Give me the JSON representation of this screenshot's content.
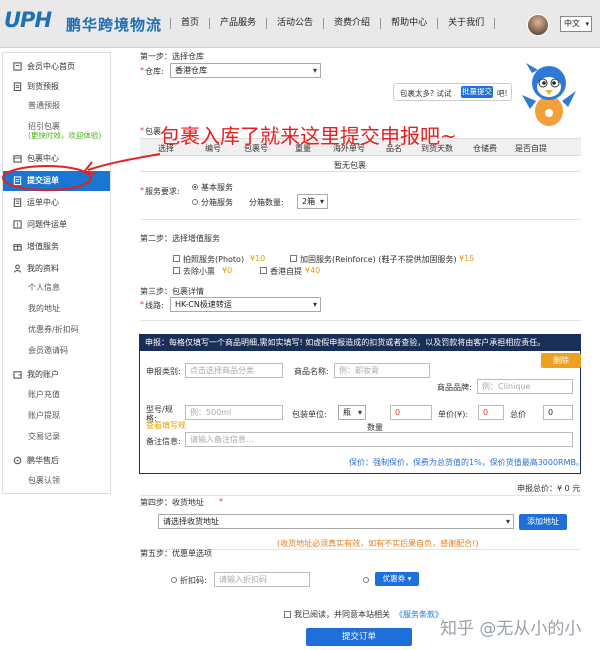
{
  "brand": {
    "logo_mark": "UPH",
    "name": "鹏华跨境物流"
  },
  "nav": [
    "首页",
    "产品服务",
    "活动公告",
    "资费介绍",
    "帮助中心",
    "关于我们"
  ],
  "lang": "中文",
  "sidebar": {
    "home": "会员中心首页",
    "arrival": "到货预报",
    "normal_forecast": "普通预报",
    "claim": "招引包裹",
    "claim_note": "(更快时效，欢迎体验)",
    "package_center": "包裹中心",
    "submit_order": "提交运单",
    "order_center": "运单中心",
    "problem_order": "问题件运单",
    "value_added": "增值服务",
    "my_profile": "我的资料",
    "personal_info": "个人信息",
    "my_address": "我的地址",
    "coupons": "优惠券/折扣码",
    "invite": "会员邀请码",
    "my_account": "我的账户",
    "recharge": "账户充值",
    "withdraw": "账户提现",
    "transactions": "交易记录",
    "after_sales": "鹏华售后",
    "claims": "包裹认领"
  },
  "step1": {
    "title": "第一步：选择仓库",
    "warehouse_label": "仓库:",
    "warehouse_value": "香港仓库",
    "too_many": "包裹太多? 试试",
    "batch_btn": "批量提交",
    "ba": "吧!"
  },
  "packages": {
    "label": "包裹",
    "columns": [
      "选择",
      "编号",
      "包裹号",
      "重量",
      "海外单号",
      "品名",
      "到货天数",
      "仓储费",
      "是否自提"
    ],
    "empty": "暂无包裹"
  },
  "service": {
    "label": "服务要求:",
    "opt1": "基本服务",
    "opt2": "分箱服务",
    "count_label": "分箱数量:",
    "count_value": "2箱"
  },
  "step2": {
    "title": "第二步：选择增值服务",
    "photo": "拍照服务(Photo)",
    "photo_price": "¥10",
    "reinforce": "加固服务(Reinforce) (鞋子不提供加固服务)",
    "reinforce_price": "¥15",
    "remove_box": "去除小票",
    "remove_price": "¥0",
    "self_pickup": "香港自提",
    "self_price": "¥40"
  },
  "step3": {
    "title": "第三步：包裹详情",
    "route_label": "线路:",
    "route_value": "HK-CN极速转运"
  },
  "declare": {
    "header": "申报：每格仅填写一个商品明细,需如实填写! 如虚假申报造成的扣货或者查验，以及罚款将由客户承担相应责任。",
    "delete": "删除",
    "category_label": "申报类别:",
    "category_ph": "点击选择商品分类",
    "name_label": "商品名称:",
    "name_ph": "例：卸妆膏",
    "brand_label": "商品品牌:",
    "brand_ph": "例：Clinique",
    "model_label": "型号/规格:",
    "model_ph": "例：500ml",
    "model_tip": "查看填写规",
    "unit_label": "包装单位:",
    "unit_value": "瓶",
    "qty_value": "0",
    "qty_label": "数量",
    "price_label": "单价(¥):",
    "price_value": "0",
    "total_label": "总价",
    "total_value": "0",
    "remark_label": "备注信息:",
    "remark_ph": "请输入备注信息...",
    "insurance": "保价：强制保价，保费为总货值的1%，保价货值最高3000RMB。"
  },
  "declare_total": "申报总价：¥ 0 元",
  "step4": {
    "title": "第四步：收货地址",
    "address_value": "请选择收货地址",
    "add_btn": "添加地址",
    "note": "(收货地址必须真实有效，如有不实后果自负，感谢配合!)"
  },
  "step5": {
    "title": "第五步：优惠单选项",
    "discount_label": "折扣码:",
    "discount_ph": "请输入折扣码",
    "coupon_btn": "优惠券"
  },
  "agree": {
    "text": "我已阅读，并同意本站相关",
    "link": "《服务条款》"
  },
  "submit": "提交订单",
  "annotation": "包裹入库了就来这里提交申报吧~",
  "watermark": "知乎 @无从小的小"
}
